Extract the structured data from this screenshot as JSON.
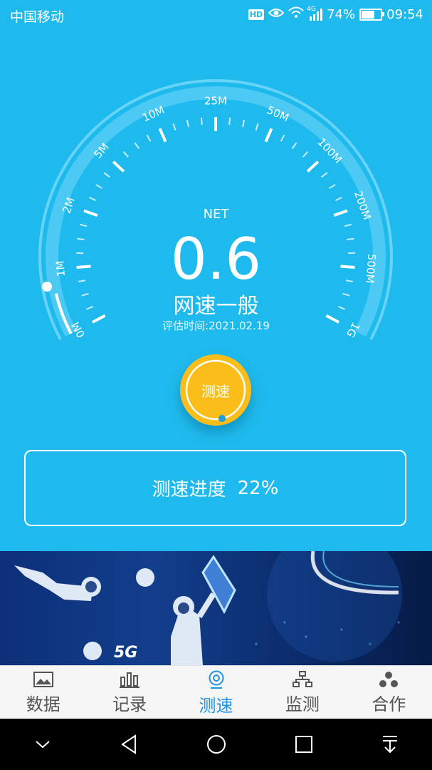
{
  "status_bar": {
    "carrier": "中国移动",
    "hd": "HD",
    "network": "4G",
    "battery": "74%",
    "battery_level": 0.74,
    "time": "09:54"
  },
  "gauge": {
    "net_label": "NET",
    "speed": "0.6",
    "quality": "网速一般",
    "eval_time": "评估时间:2021.02.19",
    "ticks": [
      "0M",
      "1M",
      "2M",
      "5M",
      "10M",
      "25M",
      "50M",
      "100M",
      "200M",
      "500M",
      "1G"
    ]
  },
  "speed_button": {
    "label": "测速"
  },
  "progress": {
    "label": "测速进度",
    "value": "22%"
  },
  "banner": {
    "tag": "5G"
  },
  "bottom_nav": {
    "items": [
      {
        "label": "数据",
        "icon": "image-icon"
      },
      {
        "label": "记录",
        "icon": "bar-chart-icon"
      },
      {
        "label": "测速",
        "icon": "webcam-icon"
      },
      {
        "label": "监测",
        "icon": "network-icon"
      },
      {
        "label": "合作",
        "icon": "cooperation-icon"
      }
    ],
    "active_index": 2
  },
  "colors": {
    "background": "#1fbaed",
    "button": "#fbbd1a",
    "active_tab": "#2193e3"
  }
}
